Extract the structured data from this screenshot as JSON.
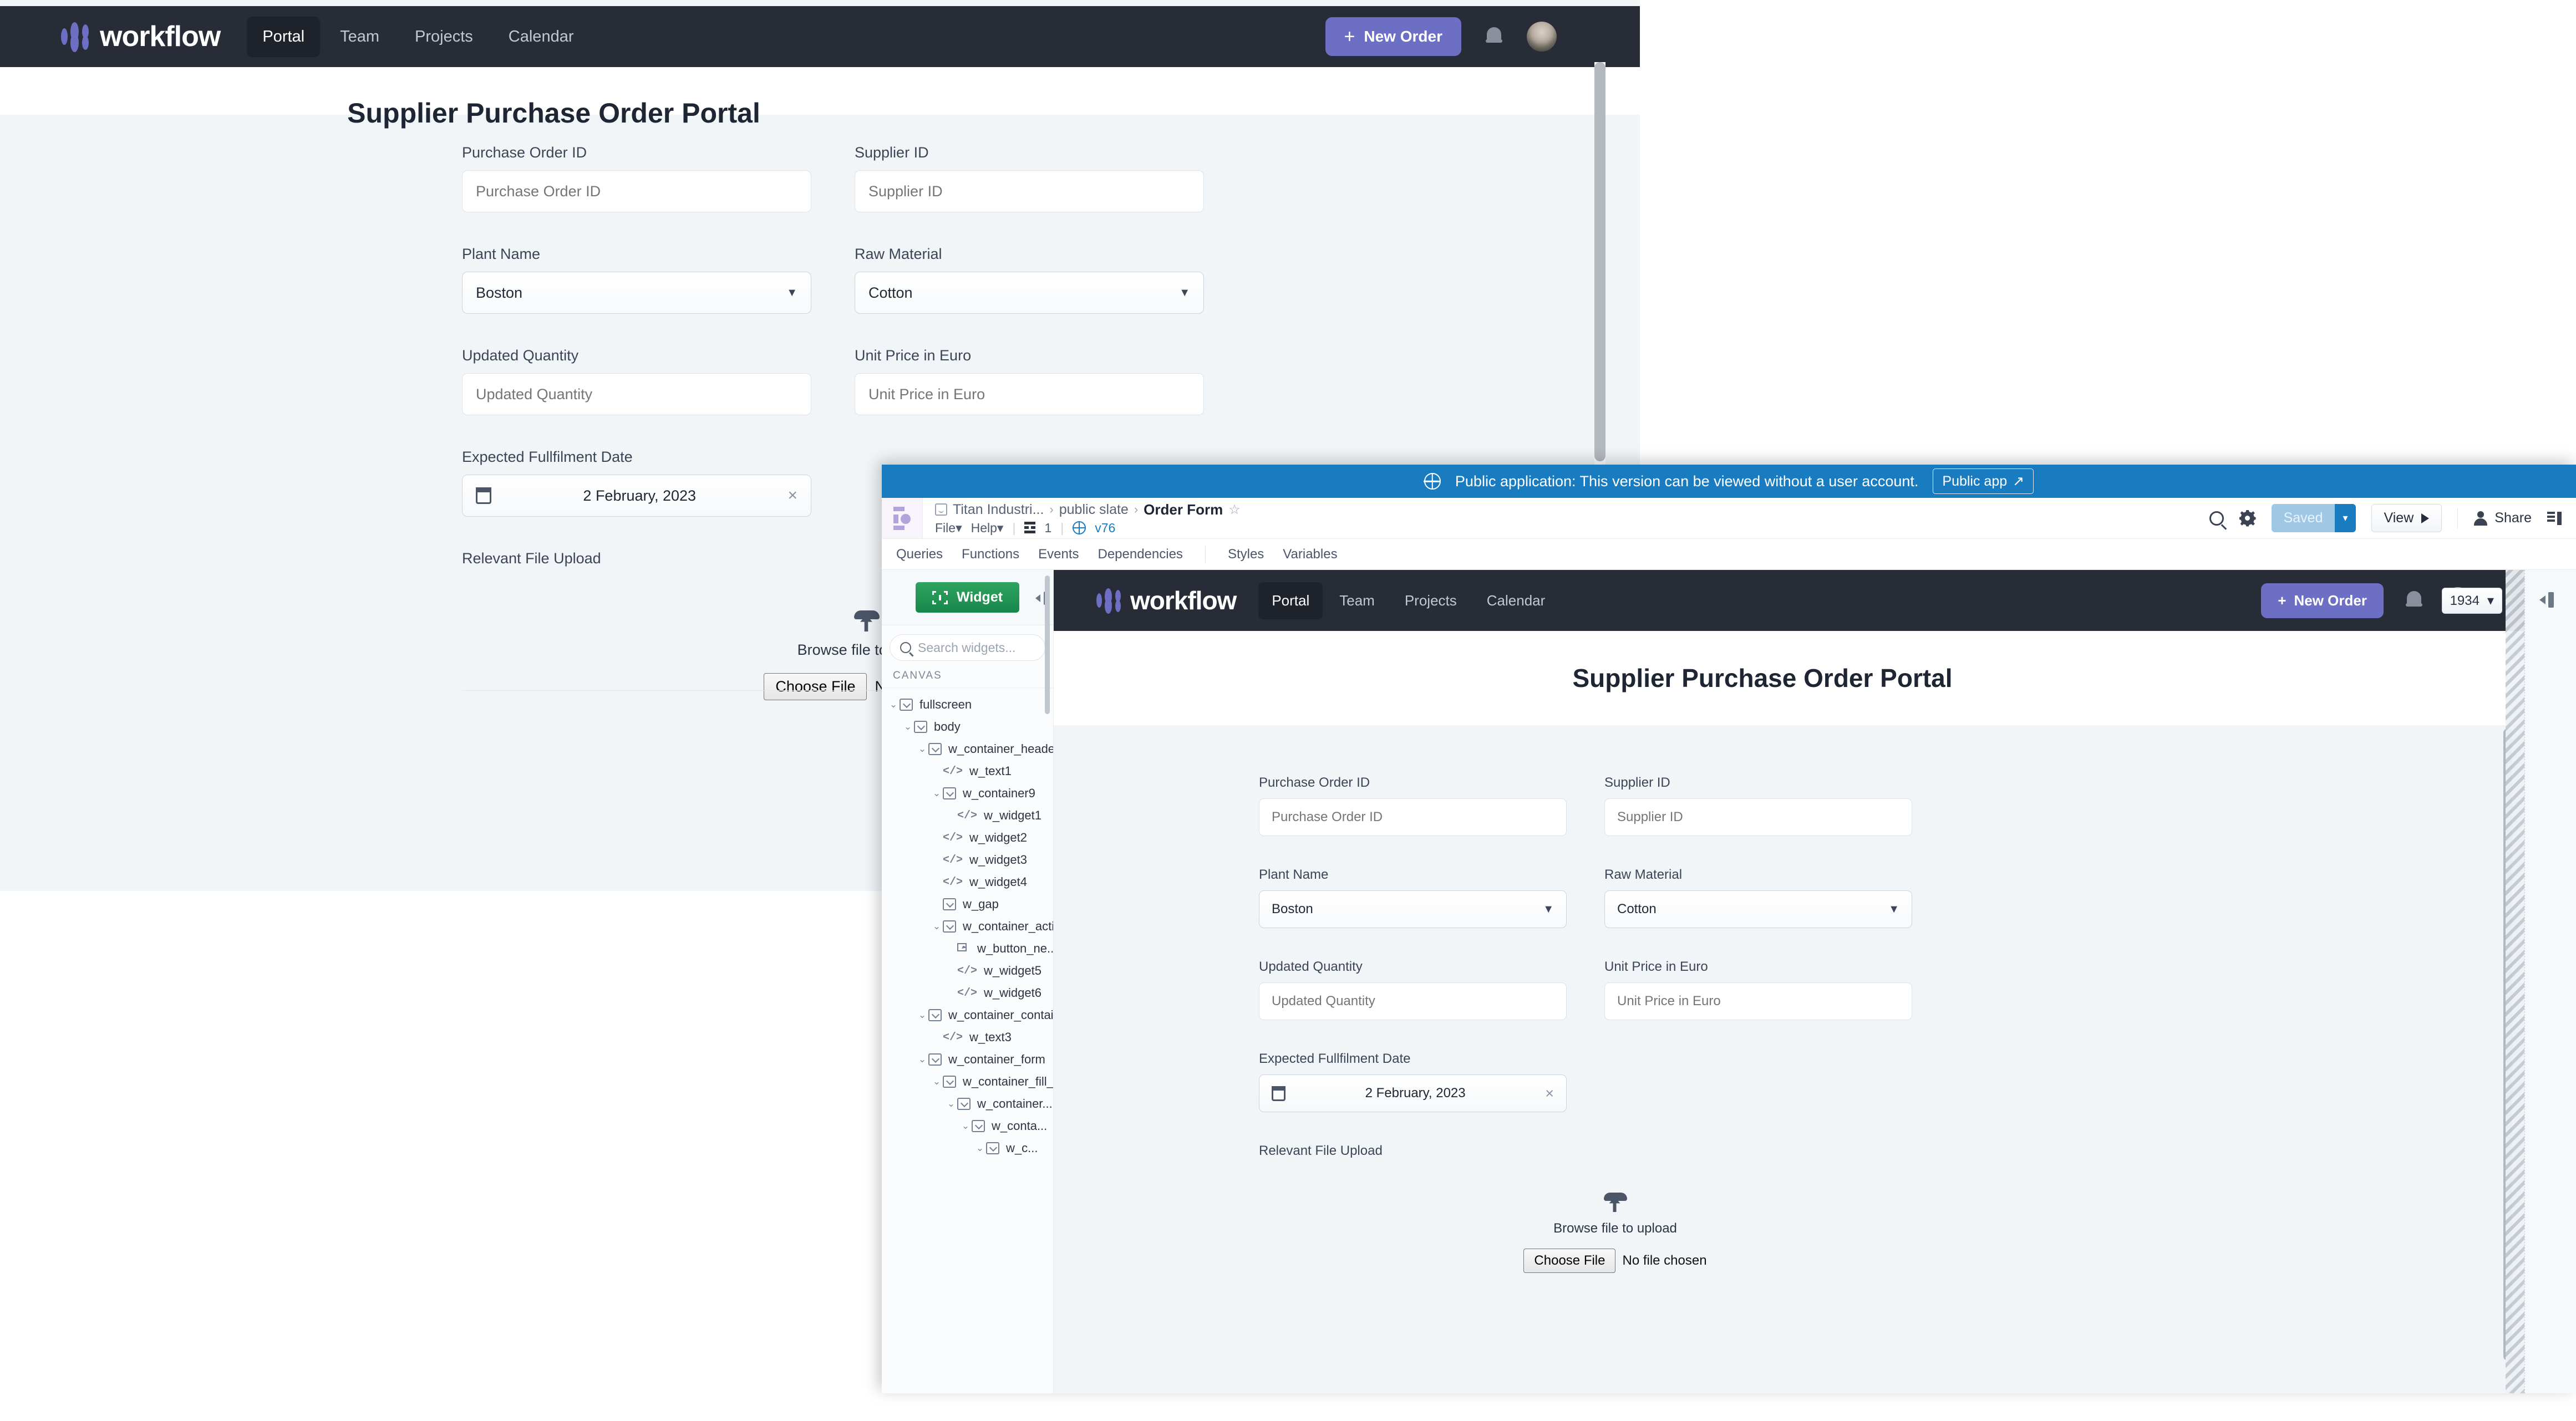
{
  "background_app": {
    "navbar": {
      "brand": "workflow",
      "links": [
        {
          "label": "Portal",
          "active": true
        },
        {
          "label": "Team",
          "active": false
        },
        {
          "label": "Projects",
          "active": false
        },
        {
          "label": "Calendar",
          "active": false
        }
      ],
      "new_order_label": "New Order",
      "plus": "+"
    },
    "page_title": "Supplier Purchase Order Portal",
    "form": {
      "fields": [
        {
          "label": "Purchase Order ID",
          "placeholder": "Purchase Order ID",
          "type": "text"
        },
        {
          "label": "Supplier ID",
          "placeholder": "Supplier ID",
          "type": "text"
        },
        {
          "label": "Plant Name",
          "value": "Boston",
          "type": "select"
        },
        {
          "label": "Raw Material",
          "value": "Cotton",
          "type": "select"
        },
        {
          "label": "Updated Quantity",
          "placeholder": "Updated Quantity",
          "type": "text"
        },
        {
          "label": "Unit Price in Euro",
          "placeholder": "Unit Price in Euro",
          "type": "text"
        },
        {
          "label": "Expected Fullfilment Date",
          "value": "2 February, 2023",
          "type": "date",
          "clear": "×"
        }
      ],
      "upload": {
        "label": "Relevant File Upload",
        "browse_text": "Browse file to upload",
        "choose_button": "Choose File",
        "file_status": "No file chosen"
      }
    }
  },
  "editor": {
    "public_banner": {
      "text": "Public application: This version can be viewed without a user account.",
      "button": "Public app",
      "button_arrow": "↗",
      "color": "#1a7cc0"
    },
    "breadcrumb": {
      "items": [
        "Titan Industri...",
        "public slate"
      ],
      "current": "Order Form",
      "separator": "›",
      "star": "☆"
    },
    "menu": {
      "file": "File",
      "help": "Help",
      "caret": "▾",
      "grid_count": "1",
      "version": "v76"
    },
    "toolbar": {
      "saved_label": "Saved",
      "saved_caret": "▾",
      "view_label": "View",
      "share_label": "Share"
    },
    "tabs": [
      "Queries",
      "Functions",
      "Events",
      "Dependencies",
      "Styles",
      "Variables"
    ],
    "widget_panel": {
      "widget_button": "Widget",
      "search_placeholder": "Search widgets...",
      "section_header": "CANVAS",
      "tree": [
        {
          "label": "fullscreen",
          "depth": 0,
          "icon": "box",
          "chevron": true
        },
        {
          "label": "body",
          "depth": 1,
          "icon": "box",
          "chevron": true
        },
        {
          "label": "w_container_header",
          "depth": 2,
          "icon": "box",
          "chevron": true
        },
        {
          "label": "w_text1",
          "depth": 3,
          "icon": "code",
          "chevron": false
        },
        {
          "label": "w_container9",
          "depth": 3,
          "icon": "box",
          "chevron": true
        },
        {
          "label": "w_widget1",
          "depth": 4,
          "icon": "code",
          "chevron": false
        },
        {
          "label": "w_widget2",
          "depth": 3,
          "icon": "code",
          "chevron": false
        },
        {
          "label": "w_widget3",
          "depth": 3,
          "icon": "code",
          "chevron": false
        },
        {
          "label": "w_widget4",
          "depth": 3,
          "icon": "code",
          "chevron": false
        },
        {
          "label": "w_gap",
          "depth": 3,
          "icon": "box",
          "chevron": false
        },
        {
          "label": "w_container_acti...",
          "depth": 3,
          "icon": "box",
          "chevron": true
        },
        {
          "label": "w_button_ne...",
          "depth": 4,
          "icon": "button",
          "chevron": false
        },
        {
          "label": "w_widget5",
          "depth": 4,
          "icon": "code",
          "chevron": false
        },
        {
          "label": "w_widget6",
          "depth": 4,
          "icon": "code",
          "chevron": false
        },
        {
          "label": "w_container_container",
          "depth": 2,
          "icon": "box",
          "chevron": true
        },
        {
          "label": "w_text3",
          "depth": 3,
          "icon": "code",
          "chevron": false
        },
        {
          "label": "w_container_form",
          "depth": 2,
          "icon": "box",
          "chevron": true
        },
        {
          "label": "w_container_fill_...",
          "depth": 3,
          "icon": "box",
          "chevron": true
        },
        {
          "label": "w_container...",
          "depth": 4,
          "icon": "box",
          "chevron": true
        },
        {
          "label": "w_conta...",
          "depth": 5,
          "icon": "box",
          "chevron": true
        },
        {
          "label": "w_c...",
          "depth": 6,
          "icon": "box",
          "chevron": true
        }
      ]
    },
    "preview": {
      "zoom_value": "1934",
      "zoom_caret": "▾",
      "navbar": {
        "brand": "workflow",
        "links": [
          {
            "label": "Portal",
            "active": true
          },
          {
            "label": "Team",
            "active": false
          },
          {
            "label": "Projects",
            "active": false
          },
          {
            "label": "Calendar",
            "active": false
          }
        ],
        "new_order_label": "New Order",
        "plus": "+"
      },
      "page_title": "Supplier Purchase Order Portal",
      "form": {
        "fields": [
          {
            "label": "Purchase Order ID",
            "placeholder": "Purchase Order ID",
            "type": "text"
          },
          {
            "label": "Supplier ID",
            "placeholder": "Supplier ID",
            "type": "text"
          },
          {
            "label": "Plant Name",
            "value": "Boston",
            "type": "select"
          },
          {
            "label": "Raw Material",
            "value": "Cotton",
            "type": "select"
          },
          {
            "label": "Updated Quantity",
            "placeholder": "Updated Quantity",
            "type": "text"
          },
          {
            "label": "Unit Price in Euro",
            "placeholder": "Unit Price in Euro",
            "type": "text"
          },
          {
            "label": "Expected Fullfilment Date",
            "value": "2 February, 2023",
            "type": "date",
            "clear": "×"
          }
        ],
        "upload": {
          "label": "Relevant File Upload",
          "browse_text": "Browse file to upload",
          "choose_button": "Choose File",
          "file_status": "No file chosen"
        }
      }
    }
  },
  "colors": {
    "navbar_bg": "#282c36",
    "accent_purple": "#6c6fc4",
    "banner_blue": "#1a7cc0",
    "widget_green": "#17874a",
    "page_bg": "#f1f5f8"
  }
}
